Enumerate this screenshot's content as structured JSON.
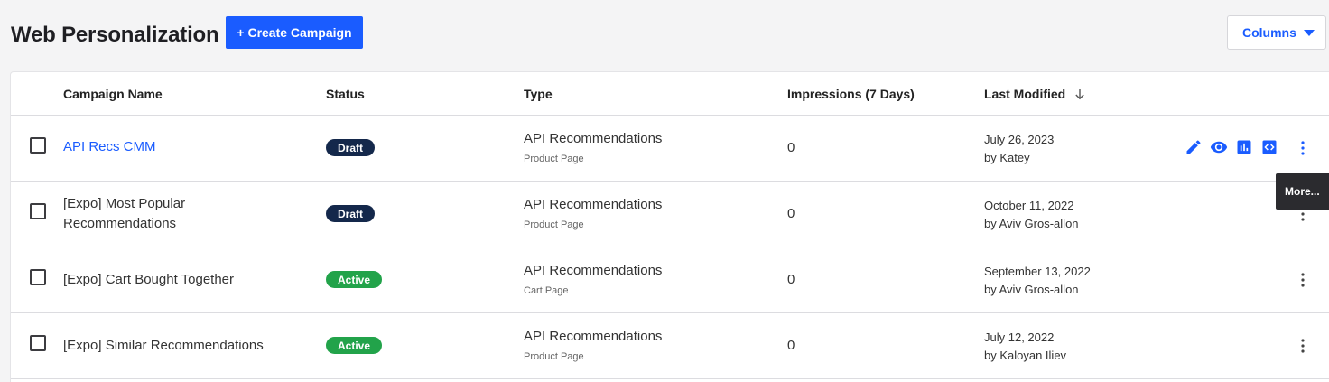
{
  "header": {
    "title": "Web Personalization",
    "create_label": "+ Create Campaign",
    "columns_label": "Columns"
  },
  "table": {
    "columns": {
      "name": "Campaign Name",
      "status": "Status",
      "type": "Type",
      "impressions": "Impressions (7 Days)",
      "modified": "Last Modified"
    },
    "rows": [
      {
        "name": "API Recs CMM",
        "status": "Draft",
        "type": "API Recommendations",
        "subtype": "Product Page",
        "impressions": "0",
        "date": "July 26, 2023",
        "by": "by Katey"
      },
      {
        "name": "[Expo] Most Popular Recommendations",
        "status": "Draft",
        "type": "API Recommendations",
        "subtype": "Product Page",
        "impressions": "0",
        "date": "October 11, 2022",
        "by": "by Aviv Gros-allon"
      },
      {
        "name": "[Expo] Cart Bought Together",
        "status": "Active",
        "type": "API Recommendations",
        "subtype": "Cart Page",
        "impressions": "0",
        "date": "September 13, 2022",
        "by": "by Aviv Gros-allon"
      },
      {
        "name": "[Expo] Similar Recommendations",
        "status": "Active",
        "type": "API Recommendations",
        "subtype": "Product Page",
        "impressions": "0",
        "date": "July 12, 2022",
        "by": "by Kaloyan Iliev"
      }
    ]
  },
  "tooltip": "More...",
  "icons": {
    "edit": "pencil-icon",
    "preview": "eye-icon",
    "report": "bar-chart-icon",
    "code": "code-icon",
    "more": "kebab-icon",
    "sort": "arrow-down-icon"
  },
  "colors": {
    "accent": "#1a5cff",
    "draft": "#14284b",
    "active": "#22a34a"
  }
}
